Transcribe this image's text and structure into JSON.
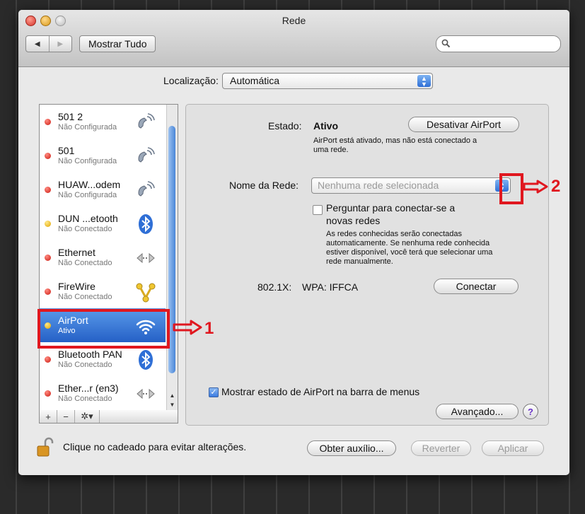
{
  "window": {
    "title": "Rede"
  },
  "toolbar": {
    "back": "◀",
    "forward": "▶",
    "show_all": "Mostrar Tudo",
    "search_placeholder": ""
  },
  "location": {
    "label": "Localização:",
    "value": "Automática"
  },
  "services": [
    {
      "name": "501 2",
      "status": "Não Configurada",
      "status_color": "red",
      "icon": "phone-modem-icon"
    },
    {
      "name": "501",
      "status": "Não Configurada",
      "status_color": "red",
      "icon": "phone-modem-icon"
    },
    {
      "name": "HUAW...odem",
      "status": "Não Configurada",
      "status_color": "red",
      "icon": "phone-modem-icon"
    },
    {
      "name": "DUN ...etooth",
      "status": "Não Conectado",
      "status_color": "yellow",
      "icon": "bluetooth-icon"
    },
    {
      "name": "Ethernet",
      "status": "Não Conectado",
      "status_color": "red",
      "icon": "ethernet-icon"
    },
    {
      "name": "FireWire",
      "status": "Não Conectado",
      "status_color": "red",
      "icon": "firewire-icon"
    },
    {
      "name": "AirPort",
      "status": "Ativo",
      "status_color": "yellow",
      "icon": "wifi-icon",
      "selected": true
    },
    {
      "name": "Bluetooth PAN",
      "status": "Não Conectado",
      "status_color": "red",
      "icon": "bluetooth-icon"
    },
    {
      "name": "Ether...r (en3)",
      "status": "Não Conectado",
      "status_color": "red",
      "icon": "ethernet-icon"
    }
  ],
  "sidebar_actions": {
    "add": "+",
    "remove": "−",
    "gear": "✲▾"
  },
  "details": {
    "state_label": "Estado:",
    "state_value": "Ativo",
    "toggle_button": "Desativar AirPort",
    "state_desc_1": "AirPort está ativado, mas não está conectado a",
    "state_desc_2": "uma rede.",
    "network_label": "Nome da Rede:",
    "network_value": "Nenhuma rede selecionada",
    "ask_line_1": "Perguntar para conectar-se a",
    "ask_line_2": "novas redes",
    "ask_desc": [
      "As redes conhecidas serão conectadas",
      "automaticamente. Se nenhuma rede conhecida",
      "estiver disponível, você terá que selecionar uma",
      "rede manualmente."
    ],
    "auth_label": "802.1X:",
    "auth_value": "WPA: IFFCA",
    "connect_button": "Conectar",
    "menu_status_label": "Mostrar estado de AirPort na barra de menus",
    "advanced_button": "Avançado...",
    "help": "?"
  },
  "footer": {
    "lock_text": "Clique no cadeado para evitar alterações.",
    "assist_button": "Obter auxílio...",
    "revert_button": "Reverter",
    "apply_button": "Aplicar"
  },
  "annotations": {
    "one": "1",
    "two": "2"
  },
  "colors": {
    "selection": "#2560c6",
    "annotation": "#e0171f",
    "status_red": "#cc1b12",
    "status_yellow": "#e0a400"
  }
}
